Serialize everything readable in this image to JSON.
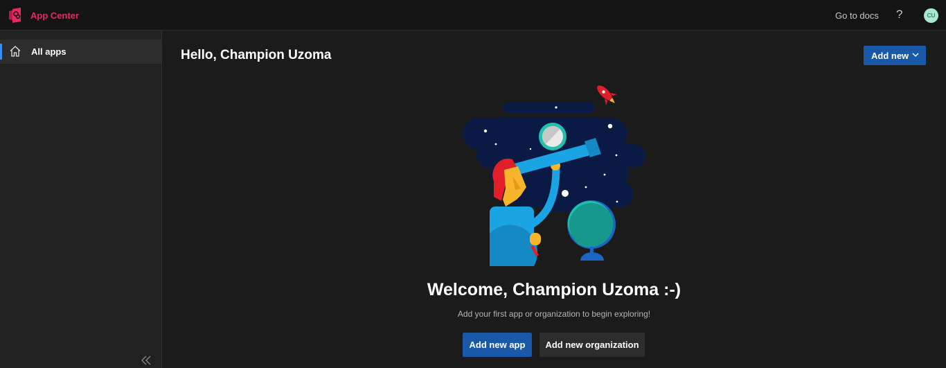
{
  "header": {
    "app_title": "App Center",
    "docs_link": "Go to docs",
    "help_label": "?",
    "avatar_initials": "CU",
    "brand_color": "#e8295f"
  },
  "sidebar": {
    "items": [
      {
        "label": "All apps",
        "icon": "home-icon",
        "selected": true
      }
    ],
    "collapse_icon": "double-chevron-left-icon"
  },
  "main": {
    "greeting": "Hello, Champion Uzoma",
    "add_new_label": "Add new",
    "welcome_title": "Welcome, Champion Uzoma :-)",
    "welcome_subtitle": "Add your first app or organization to begin exploring!",
    "add_app_label": "Add new app",
    "add_org_label": "Add new organization",
    "accent_color": "#1a58a8"
  }
}
